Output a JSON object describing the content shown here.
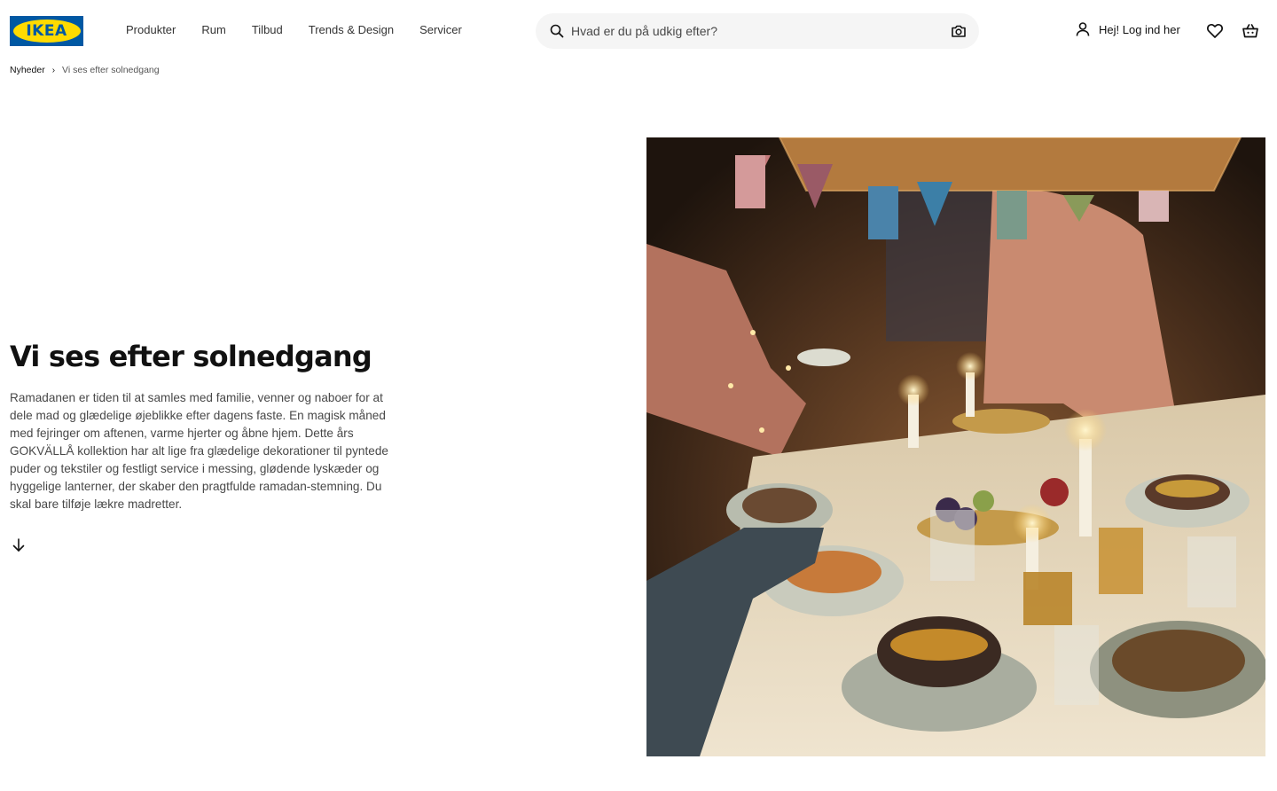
{
  "header": {
    "logo_text": "IKEA",
    "nav": [
      "Produkter",
      "Rum",
      "Tilbud",
      "Trends & Design",
      "Servicer"
    ],
    "search_placeholder": "Hvad er du på udkig efter?",
    "account_label": "Hej! Log ind her",
    "icons": [
      "search-icon",
      "camera-icon",
      "person-icon",
      "heart-icon",
      "shopping-basket-icon"
    ]
  },
  "breadcrumb": {
    "parent": "Nyheder",
    "separator": "›",
    "current": "Vi ses efter solnedgang"
  },
  "hero": {
    "title": "Vi ses efter solnedgang",
    "body": "Ramadanen er tiden til at samles med familie, venner og naboer for at dele mad og glædelige øjeblikke efter dagens faste. En magisk måned med fejringer om aftenen, varme hjerter og åbne hjem. Dette års GOKVÄLLÅ kollektion har alt lige fra glædelige dekorationer til pyntede puder og tekstiler og festligt service i messing, glødende lyskæder og hyggelige lanterner, der skaber den pragtfulde ramadan-stemning. Du skal bare tilføje lækre madretter.",
    "scroll_icon": "arrow-down-icon"
  },
  "colors": {
    "brand_blue": "#0058a3",
    "brand_yellow": "#ffdb00",
    "search_bg": "#f5f5f5"
  }
}
